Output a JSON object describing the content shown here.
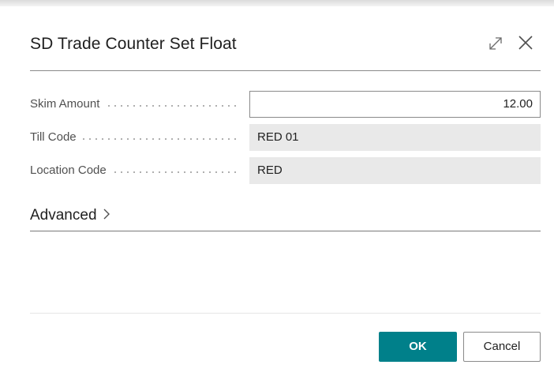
{
  "dialog": {
    "title": "SD Trade Counter Set Float",
    "expand_icon": "expand-icon",
    "close_icon": "close-icon"
  },
  "fields": [
    {
      "label": "Skim Amount",
      "value": "12.00",
      "editable": true
    },
    {
      "label": "Till Code",
      "value": "RED 01",
      "editable": false
    },
    {
      "label": "Location Code",
      "value": "RED",
      "editable": false
    }
  ],
  "advanced": {
    "label": "Advanced",
    "icon": "chevron-right-icon"
  },
  "buttons": {
    "ok": "OK",
    "cancel": "Cancel"
  },
  "colors": {
    "primary": "#00808a",
    "readonly_bg": "#e9e9e9"
  }
}
